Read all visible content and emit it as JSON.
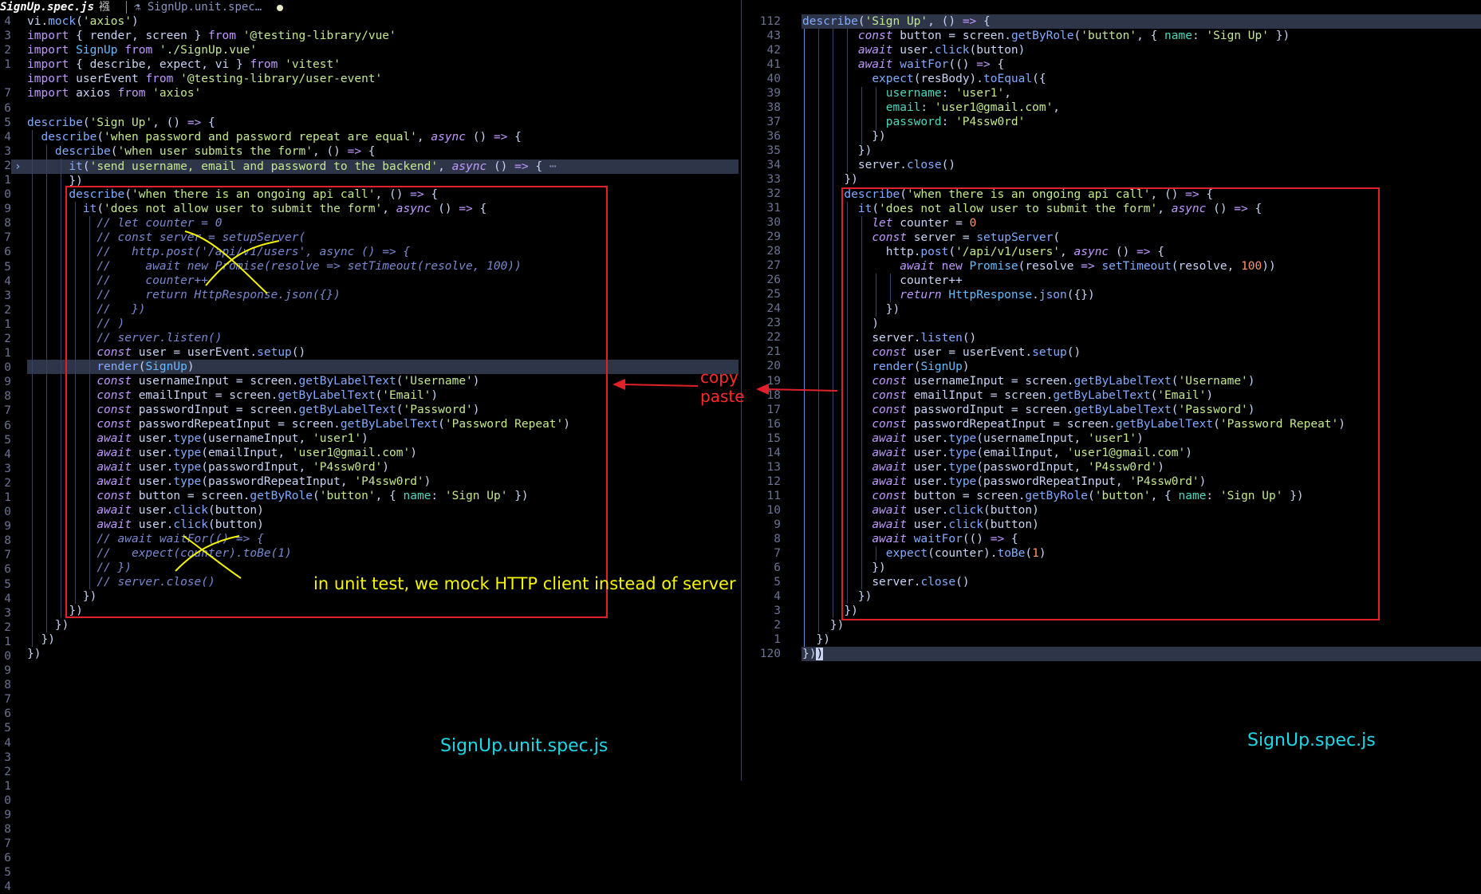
{
  "tabs": {
    "active_label": "SignUp.spec.js",
    "active_badge": "襁",
    "inactive_label": "SignUp.unit.spec…"
  },
  "left_editor": {
    "line_numbers": [
      "4",
      "3",
      "2",
      "1",
      "",
      "7",
      "6",
      "5",
      "4",
      "3",
      "2",
      "1",
      "0",
      "9",
      "8",
      "7",
      "6",
      "5",
      "4",
      "3",
      "2",
      "1",
      "2",
      "1",
      "0",
      "9",
      "8",
      "7",
      "6",
      "5",
      "4",
      "3",
      "2",
      "1",
      "0",
      "9",
      "8",
      "7",
      "6",
      "5",
      "4",
      "3",
      "2",
      "1",
      "0",
      "9",
      "8",
      "7",
      "6",
      "5",
      "4",
      "3",
      "2",
      "1",
      "0",
      "9",
      "8",
      "7",
      "6",
      "5",
      "4"
    ],
    "fold_marker": "›"
  },
  "right_editor": {
    "line_numbers": [
      "112",
      "43",
      "42",
      "41",
      "40",
      "39",
      "38",
      "37",
      "36",
      "35",
      "34",
      "33",
      "32",
      "31",
      "30",
      "29",
      "28",
      "27",
      "26",
      "25",
      "24",
      "23",
      "22",
      "21",
      "20",
      "19",
      "18",
      "17",
      "16",
      "15",
      "14",
      "13",
      "12",
      "11",
      "10",
      "9",
      "8",
      "7",
      "6",
      "5",
      "4",
      "3",
      "2",
      "1",
      "120"
    ]
  },
  "annotations": {
    "copy_paste": "copy\npaste",
    "mock_note": "in unit test, we mock HTTP client instead of server"
  },
  "labels": {
    "left_file": "SignUp.unit.spec.js",
    "right_file": "SignUp.spec.js"
  },
  "colors": {
    "background": "#000000",
    "annotation_red": "#e0202a",
    "annotation_yellow": "#f5f500",
    "file_label": "#1ed8e8"
  }
}
